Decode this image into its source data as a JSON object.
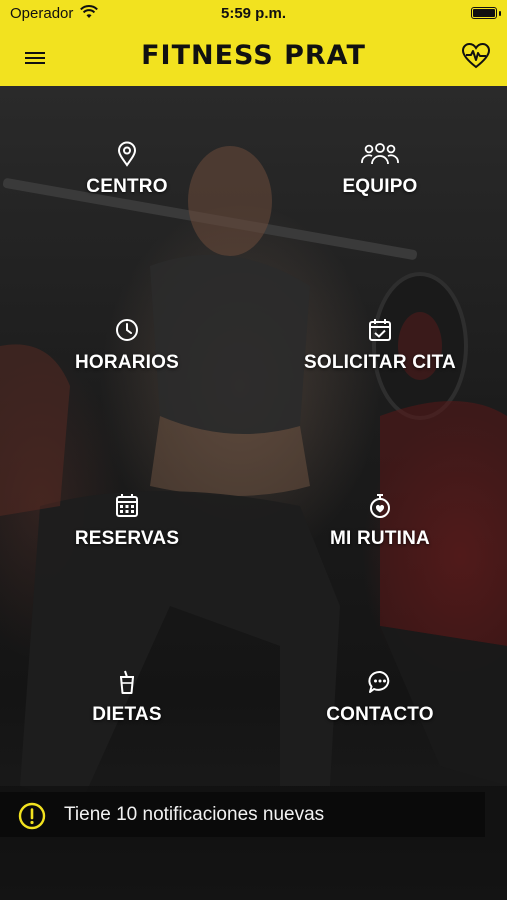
{
  "status_bar": {
    "carrier": "Operador",
    "time": "5:59 p.m."
  },
  "nav": {
    "title": "FITNESS PRAT"
  },
  "menu": [
    {
      "label": "CENTRO",
      "icon": "location-pin-icon"
    },
    {
      "label": "EQUIPO",
      "icon": "team-icon"
    },
    {
      "label": "HORARIOS",
      "icon": "clock-icon"
    },
    {
      "label": "SOLICITAR CITA",
      "icon": "calendar-check-icon"
    },
    {
      "label": "RESERVAS",
      "icon": "calendar-grid-icon"
    },
    {
      "label": "MI RUTINA",
      "icon": "stopwatch-heart-icon"
    },
    {
      "label": "DIETAS",
      "icon": "cup-icon"
    },
    {
      "label": "CONTACTO",
      "icon": "chat-bubble-icon"
    }
  ],
  "notification": {
    "text": "Tiene 10 notificaciones nuevas",
    "icon": "alert-circle-icon"
  },
  "colors": {
    "brand_yellow": "#f2e21f",
    "background": "#0b0b0b",
    "text": "#ffffff"
  }
}
